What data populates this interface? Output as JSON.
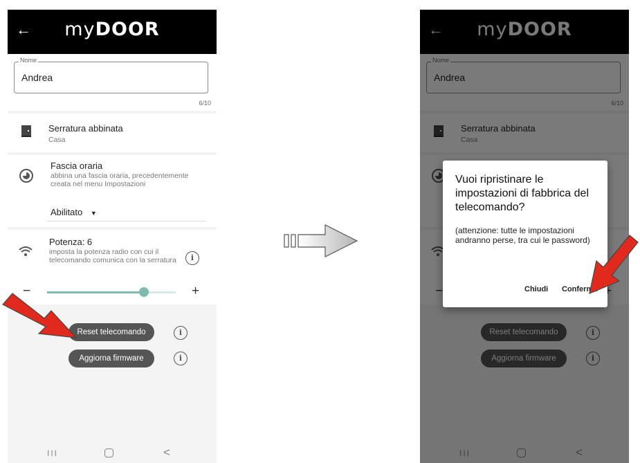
{
  "app": {
    "logo_my": "my",
    "logo_door": "DOOR",
    "back_icon": "arrow-left-icon",
    "colors": {
      "appbar": "#000000",
      "slider": "#7fbab0",
      "pill_button": "#555555",
      "callout_arrow": "#e02a1d"
    }
  },
  "name_field": {
    "label": "Nome",
    "value": "Andrea",
    "counter": "6/10"
  },
  "lock": {
    "icon": "door-icon",
    "title": "Serratura abbinata",
    "subtitle": "Casa"
  },
  "time_slot": {
    "icon": "clock-icon",
    "title": "Fascia oraria",
    "description": "abbina una fascia oraria, precedentemente creata nel menu Impostazioni",
    "select_value": "Abilitato"
  },
  "power": {
    "icon": "wifi-icon",
    "title": "Potenza: 6",
    "description": "imposta la potenza radio con cui il telecomando comunica con la serratura",
    "minus": "−",
    "plus": "+",
    "slider_value": 6,
    "slider_min": 0,
    "slider_max": 8
  },
  "actions": {
    "reset_label": "Reset telecomando",
    "firmware_label": "Aggiorna firmware"
  },
  "dialog": {
    "title": "Vuoi ripristinare le impostazioni di fabbrica del telecomando?",
    "body": "(attenzione: tutte le impostazioni andranno perse, tra cui le password)",
    "cancel_label": "Chiudi",
    "confirm_label": "Conferma"
  },
  "navbar": {
    "recents": "III",
    "back": "<"
  }
}
